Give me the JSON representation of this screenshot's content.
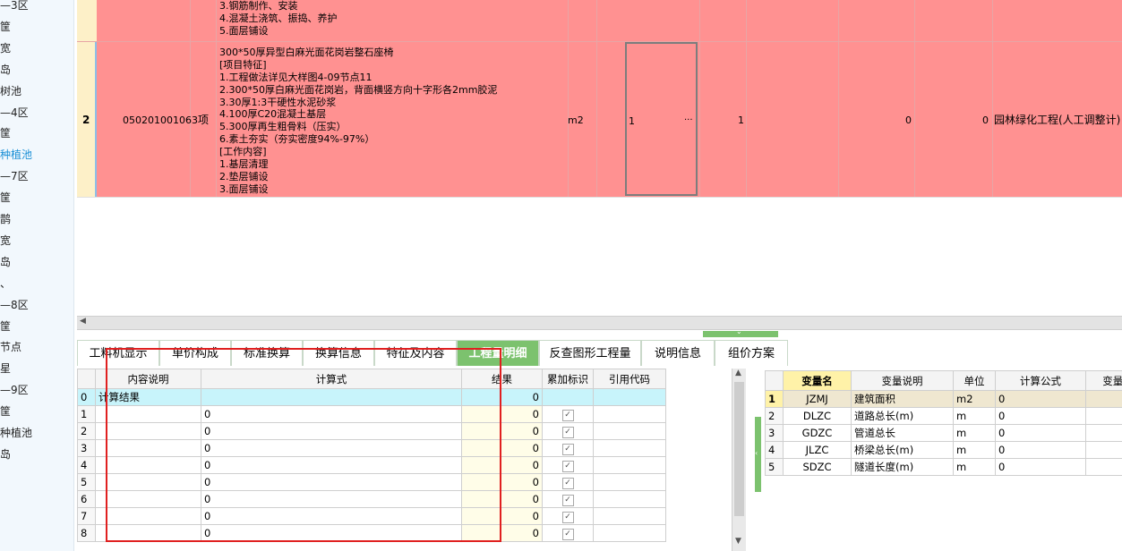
{
  "left_tree": {
    "items": [
      {
        "label": "—3区",
        "hl": false
      },
      {
        "label": "筐",
        "hl": false
      },
      {
        "label": "宽",
        "hl": false
      },
      {
        "label": "岛",
        "hl": false
      },
      {
        "label": "树池",
        "hl": false
      },
      {
        "label": "—4区",
        "hl": false
      },
      {
        "label": "筐",
        "hl": false
      },
      {
        "label": "种植池",
        "hl": true
      },
      {
        "label": "—7区",
        "hl": false
      },
      {
        "label": "筐",
        "hl": false
      },
      {
        "label": "鹊",
        "hl": false
      },
      {
        "label": "宽",
        "hl": false
      },
      {
        "label": "岛",
        "hl": false
      },
      {
        "label": "、",
        "hl": false
      },
      {
        "label": "—8区",
        "hl": false
      },
      {
        "label": "筐",
        "hl": false
      },
      {
        "label": "节点",
        "hl": false
      },
      {
        "label": "星",
        "hl": false
      },
      {
        "label": "—9区",
        "hl": false
      },
      {
        "label": "筐",
        "hl": false
      },
      {
        "label": "种植池",
        "hl": false
      },
      {
        "label": "岛",
        "hl": false
      }
    ]
  },
  "top_grid": {
    "row1_desc": [
      "3.钢筋制作、安装",
      "4.混凝土浇筑、振捣、养护",
      "5.面层铺设"
    ],
    "row2": {
      "num": "2",
      "code": "050201001063",
      "type": "项",
      "desc": [
        "300*50厚异型白麻光面花岗岩整石座椅",
        "[项目特征]",
        "1.工程做法详见大样图4-09节点11",
        "2.300*50厚白麻光面花岗岩，背面横竖方向十字形各2mm胶泥",
        "3.30厚1:3干硬性水泥砂浆",
        "4.100厚C20混凝土基层",
        "5.300厚再生粗骨料（压实）",
        "6.素土夯实（夯实密度94%-97%）",
        "[工作内容]",
        "1.基层清理",
        "2.垫层铺设",
        "3.面层铺设"
      ],
      "unit": "m2",
      "qty_expr": "1",
      "ellipsis": "···",
      "qty": "1",
      "price": "0",
      "total": "0",
      "specialty": "园林绿化工程(人工调整计)"
    }
  },
  "tabs": [
    {
      "label": "工料机显示",
      "active": false
    },
    {
      "label": "单价构成",
      "active": false
    },
    {
      "label": "标准换算",
      "active": false
    },
    {
      "label": "换算信息",
      "active": false
    },
    {
      "label": "特征及内容",
      "active": false
    },
    {
      "label": "工程量明细",
      "active": true
    },
    {
      "label": "反查图形工程量",
      "active": false
    },
    {
      "label": "说明信息",
      "active": false
    },
    {
      "label": "组价方案",
      "active": false
    }
  ],
  "detail_table": {
    "headers": [
      "内容说明",
      "计算式",
      "结果",
      "累加标识",
      "引用代码"
    ],
    "rows": [
      {
        "idx": "0",
        "desc": "计算结果",
        "expr": "",
        "result": "0",
        "check": false
      },
      {
        "idx": "1",
        "desc": "",
        "expr": "0",
        "result": "0",
        "check": true
      },
      {
        "idx": "2",
        "desc": "",
        "expr": "0",
        "result": "0",
        "check": true
      },
      {
        "idx": "3",
        "desc": "",
        "expr": "0",
        "result": "0",
        "check": true
      },
      {
        "idx": "4",
        "desc": "",
        "expr": "0",
        "result": "0",
        "check": true
      },
      {
        "idx": "5",
        "desc": "",
        "expr": "0",
        "result": "0",
        "check": true
      },
      {
        "idx": "6",
        "desc": "",
        "expr": "0",
        "result": "0",
        "check": true
      },
      {
        "idx": "7",
        "desc": "",
        "expr": "0",
        "result": "0",
        "check": true
      },
      {
        "idx": "8",
        "desc": "",
        "expr": "0",
        "result": "0",
        "check": true
      }
    ]
  },
  "var_table": {
    "headers": [
      "变量名",
      "变量说明",
      "单位",
      "计算公式",
      "变量值"
    ],
    "rows": [
      {
        "idx": "1",
        "name": "JZMJ",
        "desc": "建筑面积",
        "unit": "m2",
        "formula": "0"
      },
      {
        "idx": "2",
        "name": "DLZC",
        "desc": "道路总长(m)",
        "unit": "m",
        "formula": "0"
      },
      {
        "idx": "3",
        "name": "GDZC",
        "desc": "管道总长",
        "unit": "m",
        "formula": "0"
      },
      {
        "idx": "4",
        "name": "JLZC",
        "desc": "桥梁总长(m)",
        "unit": "m",
        "formula": "0"
      },
      {
        "idx": "5",
        "name": "SDZC",
        "desc": "隧道长度(m)",
        "unit": "m",
        "formula": "0"
      }
    ]
  },
  "colors": {
    "row_highlight": "#ff9191",
    "active_tab": "#7cc26e",
    "annotation_box": "#e02020"
  }
}
